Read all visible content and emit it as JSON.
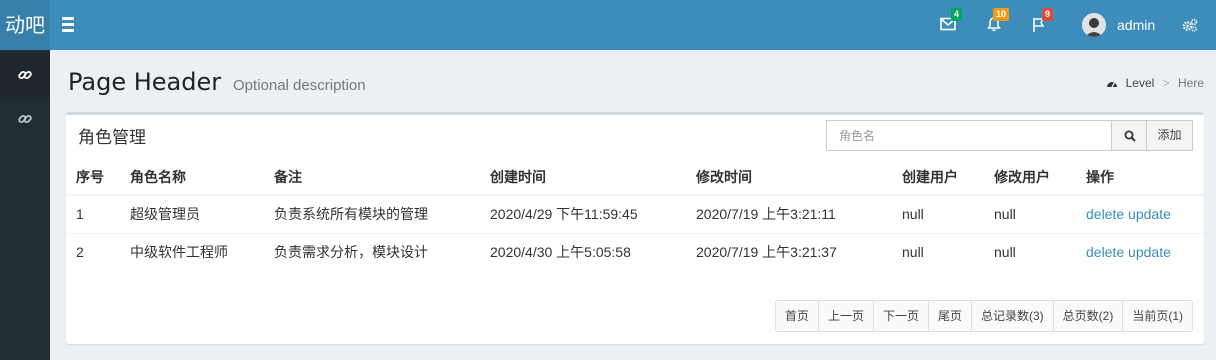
{
  "app": {
    "logo": "动吧"
  },
  "navbar": {
    "mail_badge": "4",
    "notif_badge": "10",
    "task_badge": "9",
    "user_name": "admin",
    "colors": {
      "mail": "#00a65a",
      "notif": "#f39c12",
      "task": "#dd4b39"
    }
  },
  "sidebar": {
    "items": [
      {
        "icon": "link-icon"
      },
      {
        "icon": "link-icon"
      }
    ]
  },
  "header": {
    "title": "Page Header",
    "description": "Optional description"
  },
  "breadcrumb": {
    "level": "Level",
    "here": "Here"
  },
  "box": {
    "title": "角色管理",
    "search_placeholder": "角色名",
    "add_label": "添加"
  },
  "table": {
    "headers": [
      "序号",
      "角色名称",
      "备注",
      "创建时间",
      "修改时间",
      "创建用户",
      "修改用户",
      "操作"
    ],
    "rows": [
      {
        "id": "1",
        "name": "超级管理员",
        "note": "负责系统所有模块的管理",
        "created": "2020/4/29 下午11:59:45",
        "modified": "2020/7/19 上午3:21:11",
        "created_by": "null",
        "modified_by": "null",
        "delete": "delete",
        "update": "update"
      },
      {
        "id": "2",
        "name": "中级软件工程师",
        "note": "负责需求分析，模块设计",
        "created": "2020/4/30 上午5:05:58",
        "modified": "2020/7/19 上午3:21:37",
        "created_by": "null",
        "modified_by": "null",
        "delete": "delete",
        "update": "update"
      }
    ]
  },
  "pagination": {
    "first": "首页",
    "prev": "上一页",
    "next": "下一页",
    "last": "尾页",
    "total_records": "总记录数(3)",
    "total_pages": "总页数(2)",
    "current_page": "当前页(1)"
  }
}
